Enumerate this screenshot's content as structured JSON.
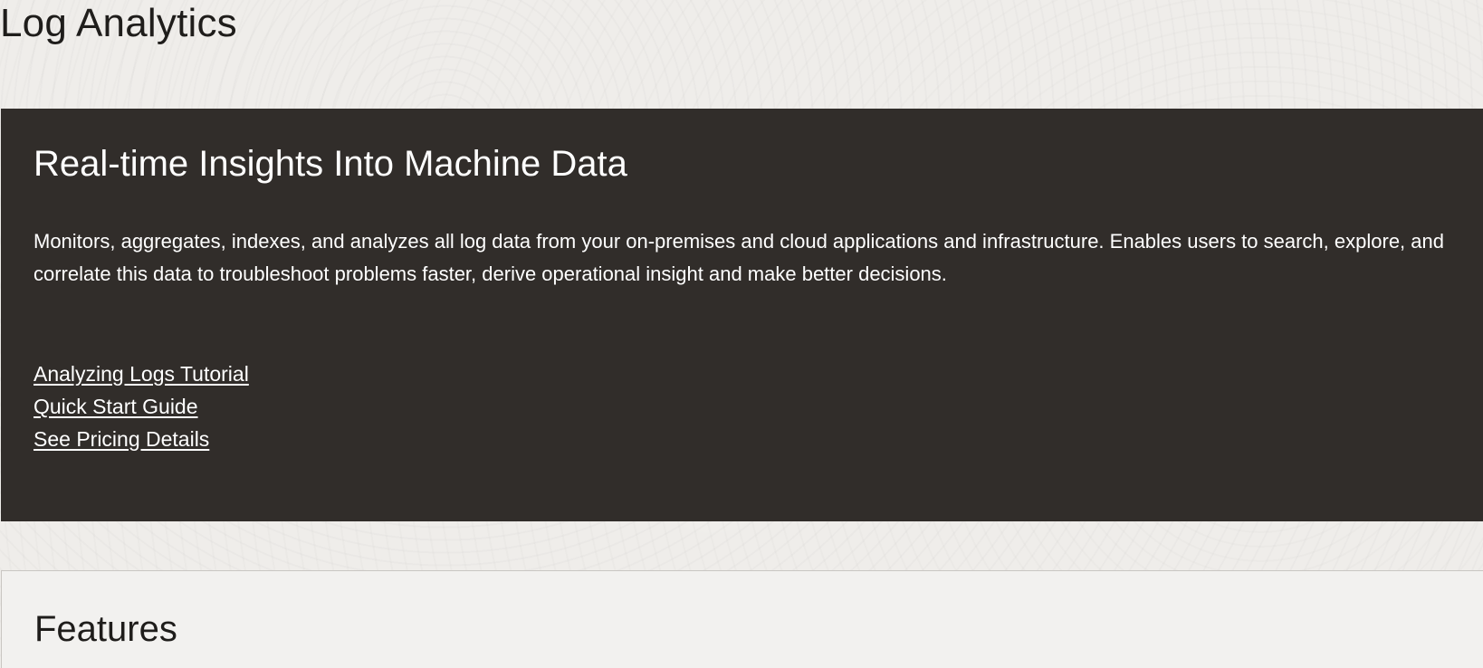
{
  "page": {
    "title": "Log Analytics"
  },
  "hero": {
    "title": "Real-time Insights Into Machine Data",
    "description": "Monitors, aggregates, indexes, and analyzes all log data from your on-premises and cloud applications and infrastructure. Enables users to search, explore, and correlate this data to troubleshoot problems faster, derive operational insight and make better decisions.",
    "links": [
      {
        "label": "Analyzing Logs Tutorial"
      },
      {
        "label": "Quick Start Guide"
      },
      {
        "label": "See Pricing Details"
      }
    ]
  },
  "features": {
    "title": "Features"
  },
  "colors": {
    "hero_background": "#312d2a",
    "page_background": "#efedea",
    "panel_background": "#f2f1ef",
    "text_dark": "#1f1d1b",
    "text_light": "#ffffff"
  }
}
